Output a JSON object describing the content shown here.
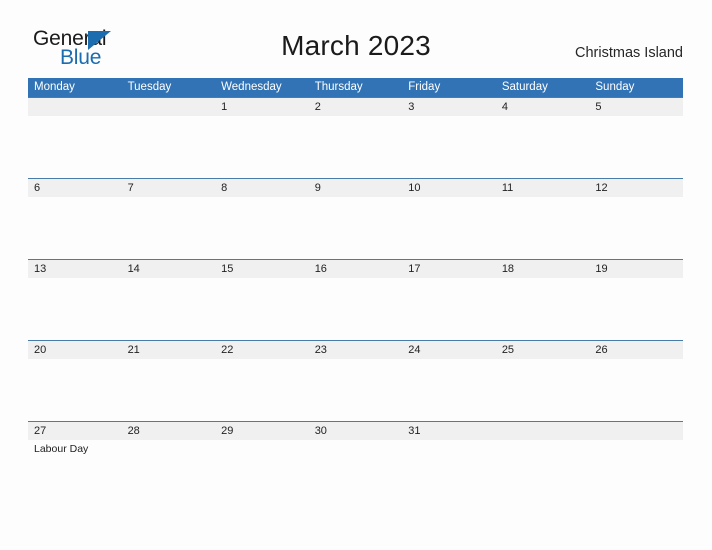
{
  "brand": {
    "name_part1": "General",
    "name_part2": "Blue",
    "triangle_color": "#1c6cb0",
    "text_color": "#1b1b1b"
  },
  "header": {
    "title": "March 2023",
    "location": "Christmas Island"
  },
  "colors": {
    "header_blue": "#3173b5",
    "band_gray": "#f0f0f0",
    "band_border": "#4a7ca8",
    "page_background": "#fdfdfd",
    "text": "#222222"
  },
  "calendar": {
    "month": "March",
    "year": "2023",
    "weekday_headers": [
      "Monday",
      "Tuesday",
      "Wednesday",
      "Thursday",
      "Friday",
      "Saturday",
      "Sunday"
    ],
    "weeks": [
      {
        "days": [
          {
            "num": "",
            "event": ""
          },
          {
            "num": "",
            "event": ""
          },
          {
            "num": "1",
            "event": ""
          },
          {
            "num": "2",
            "event": ""
          },
          {
            "num": "3",
            "event": ""
          },
          {
            "num": "4",
            "event": ""
          },
          {
            "num": "5",
            "event": ""
          }
        ]
      },
      {
        "days": [
          {
            "num": "6",
            "event": ""
          },
          {
            "num": "7",
            "event": ""
          },
          {
            "num": "8",
            "event": ""
          },
          {
            "num": "9",
            "event": ""
          },
          {
            "num": "10",
            "event": ""
          },
          {
            "num": "11",
            "event": ""
          },
          {
            "num": "12",
            "event": ""
          }
        ]
      },
      {
        "days": [
          {
            "num": "13",
            "event": ""
          },
          {
            "num": "14",
            "event": ""
          },
          {
            "num": "15",
            "event": ""
          },
          {
            "num": "16",
            "event": ""
          },
          {
            "num": "17",
            "event": ""
          },
          {
            "num": "18",
            "event": ""
          },
          {
            "num": "19",
            "event": ""
          }
        ]
      },
      {
        "days": [
          {
            "num": "20",
            "event": ""
          },
          {
            "num": "21",
            "event": ""
          },
          {
            "num": "22",
            "event": ""
          },
          {
            "num": "23",
            "event": ""
          },
          {
            "num": "24",
            "event": ""
          },
          {
            "num": "25",
            "event": ""
          },
          {
            "num": "26",
            "event": ""
          }
        ]
      },
      {
        "days": [
          {
            "num": "27",
            "event": "Labour Day"
          },
          {
            "num": "28",
            "event": ""
          },
          {
            "num": "29",
            "event": ""
          },
          {
            "num": "30",
            "event": ""
          },
          {
            "num": "31",
            "event": ""
          },
          {
            "num": "",
            "event": ""
          },
          {
            "num": "",
            "event": ""
          }
        ]
      }
    ]
  }
}
